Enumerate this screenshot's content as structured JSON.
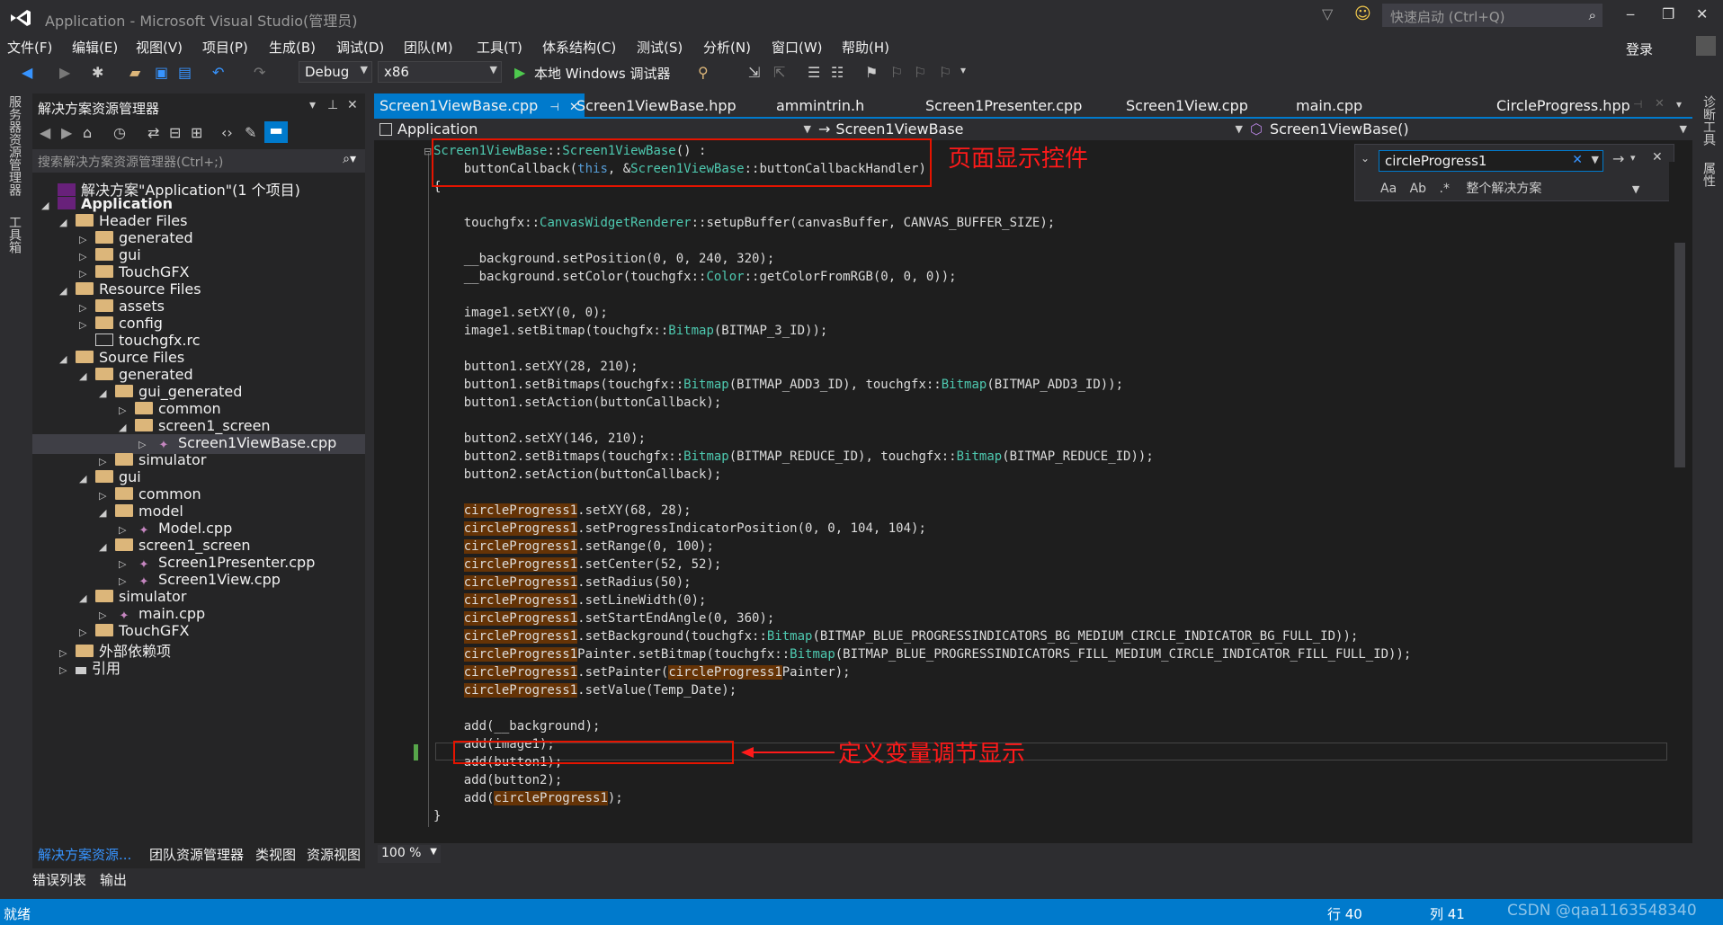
{
  "window": {
    "title": "Application - Microsoft Visual Studio(管理员)",
    "quick_launch": "快速启动 (Ctrl+Q)",
    "login": "登录"
  },
  "menu": [
    "文件(F)",
    "编辑(E)",
    "视图(V)",
    "项目(P)",
    "生成(B)",
    "调试(D)",
    "团队(M)",
    "工具(T)",
    "体系结构(C)",
    "测试(S)",
    "分析(N)",
    "窗口(W)",
    "帮助(H)"
  ],
  "toolbar": {
    "config": "Debug",
    "platform": "x86",
    "debugger": "本地 Windows 调试器"
  },
  "side_left": [
    "服务器资源管理器",
    "工具箱"
  ],
  "side_right": [
    "诊断工具",
    "属性"
  ],
  "solution": {
    "header": "解决方案资源管理器",
    "search_placeholder": "搜索解决方案资源管理器(Ctrl+;)",
    "tree": [
      {
        "label": "解决方案\"Application\"(1 个项目)"
      },
      {
        "label": "Application"
      },
      {
        "label": "Header Files"
      },
      {
        "label": "generated"
      },
      {
        "label": "gui"
      },
      {
        "label": "TouchGFX"
      },
      {
        "label": "Resource Files"
      },
      {
        "label": "assets"
      },
      {
        "label": "config"
      },
      {
        "label": "touchgfx.rc"
      },
      {
        "label": "Source Files"
      },
      {
        "label": "generated"
      },
      {
        "label": "gui_generated"
      },
      {
        "label": "common"
      },
      {
        "label": "screen1_screen"
      },
      {
        "label": "Screen1ViewBase.cpp"
      },
      {
        "label": "simulator"
      },
      {
        "label": "gui"
      },
      {
        "label": "common"
      },
      {
        "label": "model"
      },
      {
        "label": "Model.cpp"
      },
      {
        "label": "screen1_screen"
      },
      {
        "label": "Screen1Presenter.cpp"
      },
      {
        "label": "Screen1View.cpp"
      },
      {
        "label": "simulator"
      },
      {
        "label": "main.cpp"
      },
      {
        "label": "TouchGFX"
      },
      {
        "label": "外部依赖项"
      },
      {
        "label": "引用"
      }
    ],
    "tabs": [
      "解决方案资源...",
      "团队资源管理器",
      "类视图",
      "资源视图"
    ]
  },
  "bottom_tabs": [
    "错误列表",
    "输出"
  ],
  "editor": {
    "tabs": [
      "Screen1ViewBase.cpp",
      "Screen1ViewBase.hpp",
      "ammintrin.h",
      "Screen1Presenter.cpp",
      "Screen1View.cpp",
      "main.cpp",
      "CircleProgress.hpp"
    ],
    "nav": [
      "Application",
      "Screen1ViewBase",
      "Screen1ViewBase()"
    ],
    "find_text": "circleProgress1",
    "find_scope": "整个解决方案",
    "zoom": "100 %"
  },
  "annotations": {
    "top": "页面显示控件",
    "bottom": "定义变量调节显示"
  },
  "status": {
    "ready": "就绪",
    "row": "行 40",
    "col": "列 41",
    "watermark": "CSDN @qaa1163548340"
  }
}
